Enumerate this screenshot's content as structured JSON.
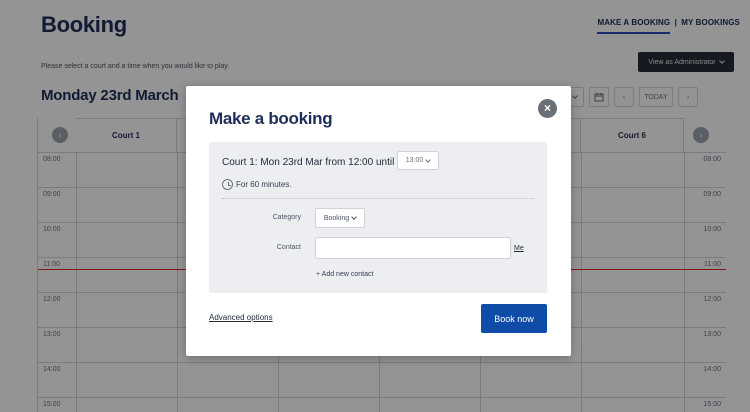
{
  "header": {
    "title": "Booking",
    "nav_active": "MAKE A BOOKING",
    "nav_separator": "|",
    "nav_other": "MY BOOKINGS",
    "admin_button": "View as Administrator",
    "instructions": "Please select a court and a time when you would like to play.",
    "date_heading": "Monday 23rd March"
  },
  "toolbar": {
    "partial_label": "e",
    "calendar_icon": "calendar-icon",
    "today": "TODAY"
  },
  "grid": {
    "columns": [
      "Court 1",
      "",
      "",
      "",
      "",
      "Court 6"
    ],
    "times": [
      "08:00",
      "09:00",
      "10:00",
      "11:00",
      "12:00",
      "13:00",
      "14:00",
      "15:00"
    ],
    "now_line_color": "#dc2626"
  },
  "modal": {
    "title": "Make a booking",
    "close_label": "×",
    "summary": "Court 1: Mon 23rd Mar from 12:00 until",
    "until_value": "13:00",
    "duration": "For 60 minutes.",
    "category_label": "Category",
    "category_value": "Booking",
    "contact_label": "Contact",
    "contact_value": "",
    "me_link": "Me",
    "add_contact": "+ Add new contact",
    "advanced_options": "Advanced options",
    "book_button": "Book now"
  },
  "colors": {
    "brand_navy": "#1f2d5a",
    "primary_button": "#0e4ca8",
    "panel_bg": "#eceef2"
  }
}
